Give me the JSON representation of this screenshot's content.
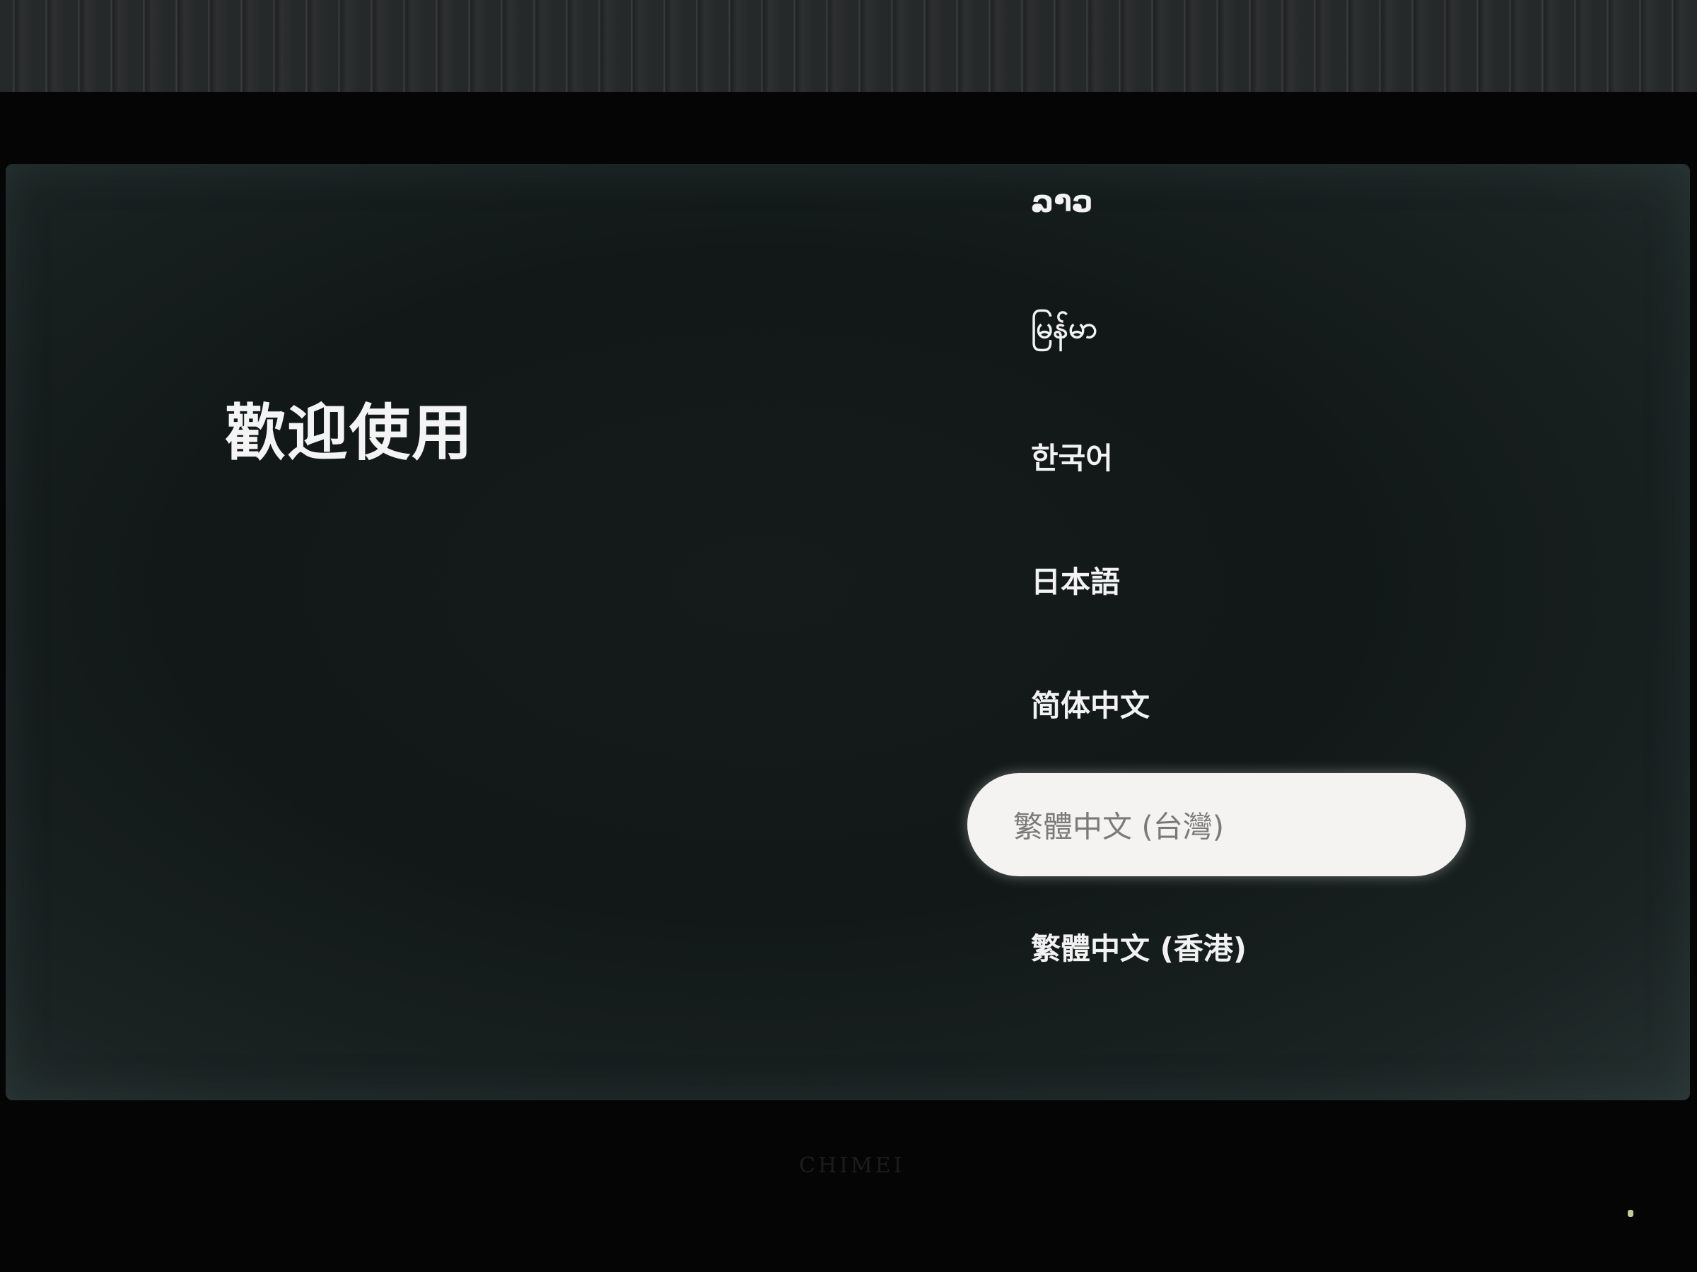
{
  "header": {
    "welcome_title": "歡迎使用"
  },
  "languages": {
    "items": [
      {
        "label": "ລາວ"
      },
      {
        "label": "မြန်မာ"
      },
      {
        "label": "한국어"
      },
      {
        "label": "日本語"
      },
      {
        "label": "简体中文"
      },
      {
        "label": "繁體中文 (台灣)",
        "selected": true
      },
      {
        "label": "繁體中文 (香港)"
      }
    ]
  },
  "tv": {
    "brand": "CHIMEI"
  },
  "colors": {
    "screen_bg": "#121818",
    "selected_bg": "#f5f3f1",
    "text": "#f2f2f2",
    "selected_text": "#7a7a7a"
  }
}
